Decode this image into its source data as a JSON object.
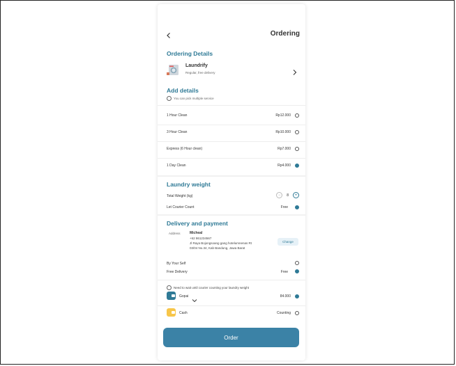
{
  "header": {
    "back_icon": "chevron-left-icon",
    "title": "Ordering"
  },
  "ordering_details": {
    "title": "Ordering Details",
    "laundry_name": "Laundrify",
    "laundry_sub": "Regular, free delivery",
    "chevron_icon": "chevron-right-icon"
  },
  "add_details": {
    "title": "Add details",
    "info": "You can pick multiple service",
    "services": [
      {
        "label": "1 Hour Clean",
        "price": "Rp12.000",
        "selected": false
      },
      {
        "label": "3 Hour Clean",
        "price": "Rp10.000",
        "selected": false
      },
      {
        "label": "Express (6 Hour clean)",
        "price": "Rp7.000",
        "selected": false
      },
      {
        "label": "1 Day Clean",
        "price": "Rp4.000",
        "selected": true
      }
    ]
  },
  "laundry_weight": {
    "title": "Laundry weight",
    "total_label": "Total Weight (kg)",
    "total_value": "8",
    "courier_label": "Let Courier Count",
    "courier_value": "Free"
  },
  "delivery": {
    "title": "Delivery and payment",
    "address_label": "Address",
    "name": "Micheal",
    "phone": "+62 861234567",
    "address_line1": "Jl Raya Bojongsoang gang hotelumnenas Rt",
    "address_line2": "03/04 No.34, Kab Bandung, Jawa Barat",
    "change_label": "Change",
    "by_yourself_label": "By Your Self",
    "free_delivery_label": "Free Delivery",
    "free_delivery_value": "Free"
  },
  "payment": {
    "info": "Need to wait until courier counting your laundry weight",
    "gopay_label": "Gopai",
    "gopay_value": "84.000",
    "cash_label": "Cash",
    "cash_value": "Counting"
  },
  "order_button": "Order",
  "colors": {
    "accent": "#2f7a96",
    "button": "#3b82a6"
  }
}
